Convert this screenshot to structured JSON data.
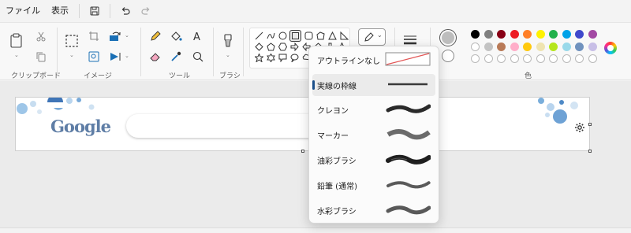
{
  "menu": {
    "file": "ファイル",
    "view": "表示"
  },
  "ribbon": {
    "groups": {
      "clipboard": "クリップボード",
      "image": "イメージ",
      "tools": "ツール",
      "brushes": "ブラシ",
      "colors": "色"
    }
  },
  "colors": {
    "row1": [
      "#000000",
      "#7f7f7f",
      "#880015",
      "#ed1c24",
      "#ff7f27",
      "#fff200",
      "#22b14c",
      "#00a2e8",
      "#3f48cc",
      "#a349a4"
    ],
    "row2": [
      "#ffffff",
      "#c3c3c3",
      "#b97a57",
      "#ffaec9",
      "#ffc90e",
      "#efe4b0",
      "#b5e61d",
      "#99d9ea",
      "#7092be",
      "#c8bfe7"
    ],
    "accent": "#1b4f8a"
  },
  "outline_menu": {
    "items": [
      {
        "label": "アウトラインなし",
        "style": "none"
      },
      {
        "label": "実線の枠線",
        "style": "solid"
      },
      {
        "label": "クレヨン",
        "style": "crayon"
      },
      {
        "label": "マーカー",
        "style": "marker"
      },
      {
        "label": "油彩ブラシ",
        "style": "oil"
      },
      {
        "label": "鉛筆 (通常)",
        "style": "pencil"
      },
      {
        "label": "水彩ブラシ",
        "style": "watercolor"
      }
    ],
    "selected_index": 1
  },
  "canvas_content": {
    "logo_text": "Google"
  }
}
